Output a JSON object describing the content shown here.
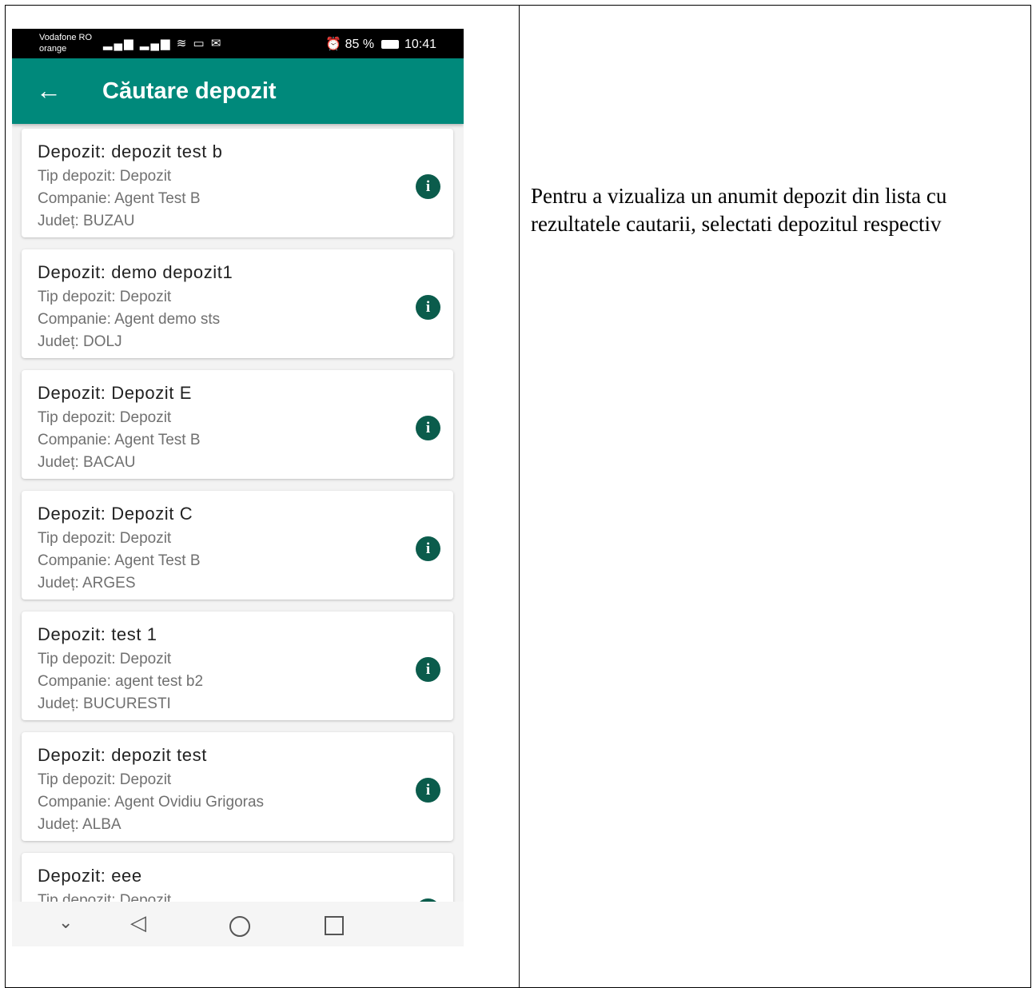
{
  "status_bar": {
    "carrier_1": "Vodafone RO",
    "carrier_2": "orange",
    "battery": "85 %",
    "time": "10:41"
  },
  "app_bar": {
    "title": "Căutare depozit"
  },
  "items": [
    {
      "name": "Depozit: depozit test b",
      "type": "Tip depozit: Depozit",
      "company": "Companie: Agent Test B",
      "county": "Județ: BUZAU"
    },
    {
      "name": "Depozit: demo depozit1",
      "type": "Tip depozit: Depozit",
      "company": "Companie: Agent demo sts",
      "county": "Județ: DOLJ"
    },
    {
      "name": "Depozit: Depozit E",
      "type": "Tip depozit: Depozit",
      "company": "Companie: Agent Test B",
      "county": "Județ: BACAU"
    },
    {
      "name": "Depozit: Depozit C",
      "type": "Tip depozit: Depozit",
      "company": "Companie: Agent Test B",
      "county": "Județ: ARGES"
    },
    {
      "name": "Depozit: test 1",
      "type": "Tip depozit: Depozit",
      "company": "Companie: agent test b2",
      "county": "Județ: BUCURESTI"
    },
    {
      "name": "Depozit: depozit test",
      "type": "Tip depozit: Depozit",
      "company": "Companie: Agent Ovidiu Grigoras",
      "county": "Județ: ALBA"
    },
    {
      "name": "Depozit: eee",
      "type": "Tip depozit: Depozit",
      "company": "",
      "county": ""
    }
  ],
  "description": "Pentru a vizualiza un anumit depozit din lista cu rezultatele cautarii, selectati depozitul respectiv",
  "colors": {
    "app_bar": "#00897b",
    "info_icon": "#0b5c4c"
  }
}
